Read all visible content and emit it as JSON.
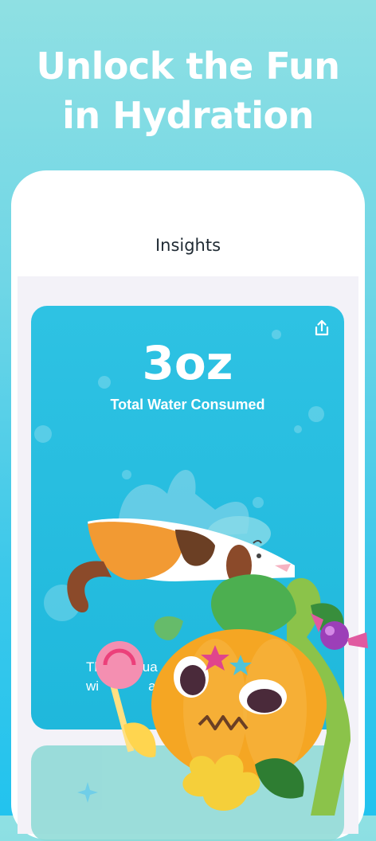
{
  "headline": {
    "line1": "Unlock the Fun",
    "line2": "in Hydration"
  },
  "screen": {
    "title": "Insights"
  },
  "card": {
    "amount": "3oz",
    "label": "Total Water Consumed",
    "text_line1": "Th",
    "text_line1_b": "oqua",
    "text_line2": "wi",
    "text_line2_b": "a ca",
    "share_icon": "share-icon"
  },
  "colors": {
    "card_blue": "#1fb8dc",
    "background_top": "#8fe0e3",
    "background_bottom": "#22c3ee",
    "pumpkin": "#f5a623"
  }
}
